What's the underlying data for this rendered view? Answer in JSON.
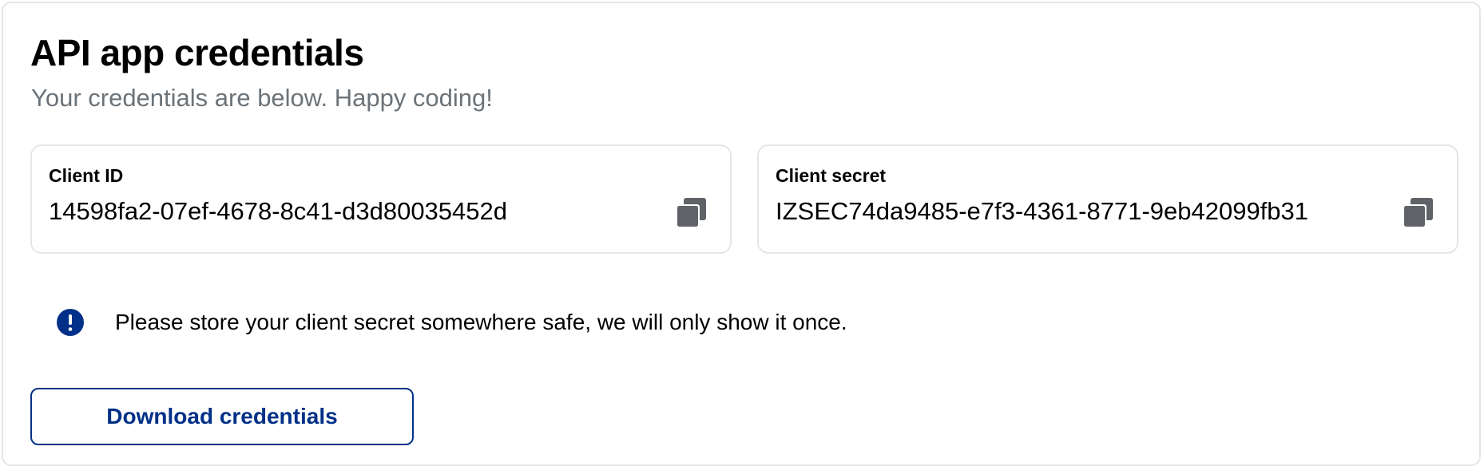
{
  "header": {
    "title": "API app credentials",
    "subtitle": "Your credentials are below. Happy coding!"
  },
  "credentials": {
    "client_id": {
      "label": "Client ID",
      "value": "14598fa2-07ef-4678-8c41-d3d80035452d",
      "copy_icon": "copy-icon"
    },
    "client_secret": {
      "label": "Client secret",
      "value": "IZSEC74da9485-e7f3-4361-8771-9eb42099fb31",
      "copy_icon": "copy-icon"
    }
  },
  "notice": {
    "icon": "exclamation-circle-icon",
    "text": "Please store your client secret somewhere safe, we will only show it once."
  },
  "actions": {
    "download_label": "Download credentials"
  },
  "colors": {
    "brand_blue": "#003087",
    "muted_text": "#6c7378",
    "border": "#e6e6e6",
    "icon_gray": "#5f6368"
  }
}
